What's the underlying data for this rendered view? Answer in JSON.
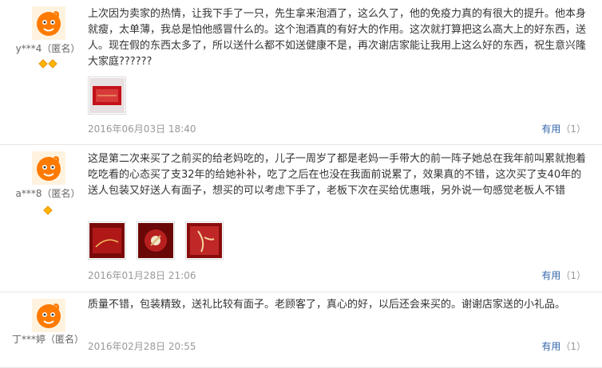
{
  "reviews": [
    {
      "user": "y***4（匿名）",
      "badge_count": 2,
      "content": "上次因为卖家的热情，让我下手了一只，先生拿来泡酒了，这么久了，他的免疫力真的有很大的提升。他本身就瘦，太单薄，我总是怕他感冒什么的。这个泡酒真的有好大的作用。这次就打算把这么高大上的好东西，送人。现在假的东西太多了，所以送什么都不如送健康不是，再次谢店家能让我用上这么好的东西，祝生意兴隆大家庭??????",
      "photo_count": 1,
      "date": "2016年06月03日 18:40",
      "useful_label": "有用",
      "useful_count": "（1）"
    },
    {
      "user": "a***8（匿名）",
      "badge_count": 1,
      "content": "这是第二次来买了之前买的给老妈吃的，儿子一周岁了都是老妈一手带大的前一阵子她总在我年前叫累就抱着吃吃看的心态买了支32年的给她补补，吃了之后在也没在我面前说累了，效果真的不错，这次买了支40年的送人包装又好送人有面子，想买的可以考虑下手了，老板下次在买给优惠哦，另外说一句感觉老板人不错",
      "photo_count": 3,
      "date": "2016年01月28日 21:06",
      "useful_label": "有用",
      "useful_count": "（1）"
    },
    {
      "user": "丁***婷（匿名）",
      "badge_count": 0,
      "content": "质量不错，包装精致，送礼比较有面子。老顾客了，真心的好，以后还会来买的。谢谢店家送的小礼品。",
      "photo_count": 0,
      "date": "2016年02月28日 20:55",
      "useful_label": "有用",
      "useful_count": "（1）"
    }
  ],
  "colors": {
    "accent_link": "#3366aa",
    "avatar_orange": "#ff7a00",
    "badge_gold": "#ffb400"
  },
  "icons": {
    "avatar": "orange-mascot-avatar-icon",
    "badge": "diamond-badge-icon"
  }
}
